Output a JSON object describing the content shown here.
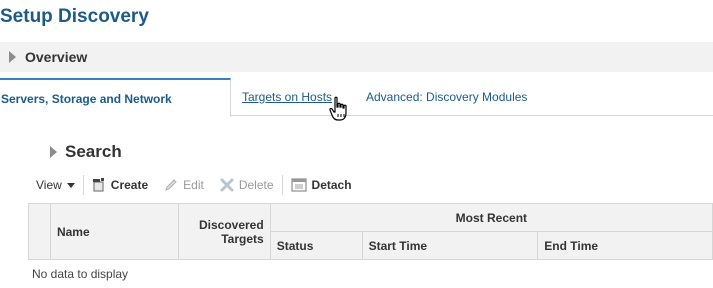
{
  "page": {
    "title": "Setup Discovery"
  },
  "overview": {
    "label": "Overview"
  },
  "tabs": [
    {
      "label": "Servers, Storage and Network",
      "active": true
    },
    {
      "label": "Targets on Hosts",
      "active": false
    },
    {
      "label": "Advanced: Discovery Modules",
      "active": false
    }
  ],
  "search": {
    "label": "Search"
  },
  "toolbar": {
    "view_label": "View",
    "create_label": "Create",
    "edit_label": "Edit",
    "delete_label": "Delete",
    "detach_label": "Detach"
  },
  "table": {
    "columns": {
      "name": "Name",
      "discovered_line1": "Discovered",
      "discovered_line2": "Targets",
      "most_recent": "Most Recent",
      "status": "Status",
      "start_time": "Start Time",
      "end_time": "End Time"
    },
    "empty_message": "No data to display"
  },
  "colors": {
    "accent": "#1c5a8a",
    "tab_border": "#3b7fbf",
    "header_bg": "#f2f2f2",
    "border": "#d6d6d6"
  }
}
